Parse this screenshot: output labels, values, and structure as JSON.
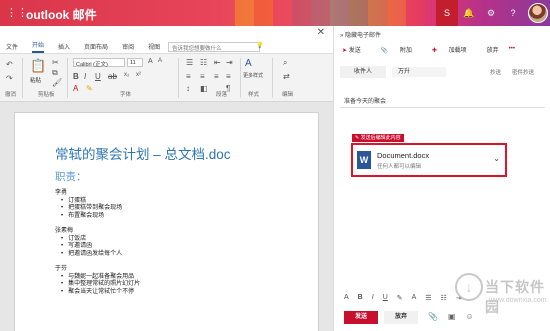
{
  "topbar": {
    "app_title": "outlook 邮件",
    "icons": [
      "skype-icon",
      "bell-icon",
      "gear-icon",
      "help-icon"
    ]
  },
  "word": {
    "tabs": [
      "文件",
      "开始",
      "插入",
      "页面布局",
      "审阅",
      "视图"
    ],
    "active_tab": "开始",
    "tellme_placeholder": "告诉我您想要做什么",
    "ribbon": {
      "font_name": "Calibri (正文)",
      "font_size": "11",
      "paste_label": "粘贴",
      "more_styles_label": "更多样式",
      "groups": [
        "撤消",
        "剪贴板",
        "字体",
        "段落",
        "样式",
        "编辑"
      ]
    },
    "document": {
      "title": "常轼的聚会计划 – 总文档.doc",
      "subtitle": "职责：",
      "sections": [
        {
          "name": "李勇",
          "items": [
            "订蛋糕",
            "把蛋糕带到聚会现场",
            "布置聚会现场"
          ]
        },
        {
          "name": "张素梅",
          "items": [
            "订饭店",
            "写邀请函",
            "把邀请函发给每个人"
          ]
        },
        {
          "name": "于芬",
          "items": [
            "与魏妮一起准备聚会用品",
            "集中整理常轼的照片幻灯片",
            "聚会当天让常轼忙个不停"
          ]
        }
      ]
    }
  },
  "compose": {
    "header": "隐藏电子邮件",
    "toolbar": {
      "send": "发送",
      "attach": "附加",
      "addin": "加载项",
      "discard": "放弃",
      "more": "•••"
    },
    "to_label": "收件人",
    "to_value": "万升",
    "cc": "抄送",
    "bcc": "密件抄送",
    "subject": "准备今天的聚会",
    "edit_label": "发送后编辑此内容",
    "attachment": {
      "name": "Document.docx",
      "permission": "任何人都可以编辑"
    },
    "send_button": "发送",
    "discard_button": "放弃"
  },
  "watermark": {
    "text": "当下软件园",
    "url": "www.downxia.com"
  }
}
